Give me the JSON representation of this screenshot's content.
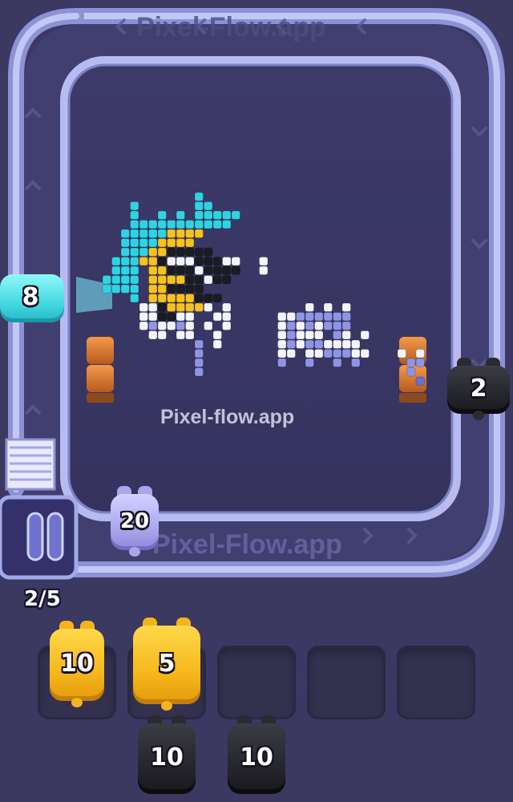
{
  "game": {
    "watermark": "Pixel-flow.app",
    "edge_watermark": "Pixel-Flow.app",
    "slots_counter": "2/5",
    "active_shooters": [
      {
        "value": "8",
        "color": "cyan"
      },
      {
        "value": "2",
        "color": "black"
      },
      {
        "value": "20",
        "color": "lavender"
      }
    ],
    "slot_shooters": [
      {
        "value": "10",
        "color": "yellow"
      },
      {
        "value": "5",
        "color": "yellow"
      }
    ],
    "queue_shooters": [
      {
        "value": "10",
        "color": "black"
      },
      {
        "value": "10",
        "color": "black"
      }
    ],
    "empty_slots": 3
  },
  "colors": {
    "background": "#3b3862",
    "track": "#a3a9e8",
    "board": "#3a3865",
    "pixel_cyan": "#2fd3e3",
    "pixel_yellow": "#f7c21e",
    "pixel_black": "#1b1b22",
    "pixel_white": "#f4f4ff",
    "pixel_lavender": "#8f94e6",
    "pixel_blue": "#6a6fd6",
    "obstacle": "#d8782e"
  }
}
